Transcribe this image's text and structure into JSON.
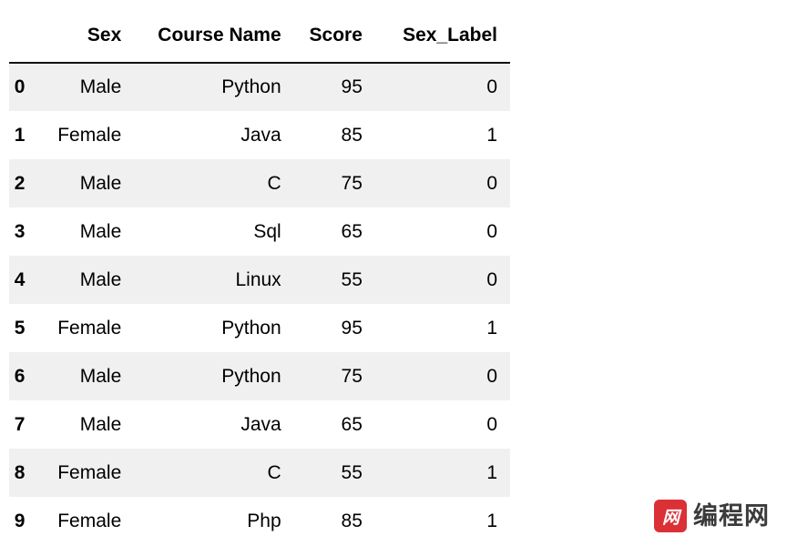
{
  "table": {
    "index_header": "",
    "columns": [
      "Sex",
      "Course Name",
      "Score",
      "Sex_Label"
    ],
    "rows": [
      {
        "index": "0",
        "sex": "Male",
        "course": "Python",
        "score": "95",
        "sex_label": "0"
      },
      {
        "index": "1",
        "sex": "Female",
        "course": "Java",
        "score": "85",
        "sex_label": "1"
      },
      {
        "index": "2",
        "sex": "Male",
        "course": "C",
        "score": "75",
        "sex_label": "0"
      },
      {
        "index": "3",
        "sex": "Male",
        "course": "Sql",
        "score": "65",
        "sex_label": "0"
      },
      {
        "index": "4",
        "sex": "Male",
        "course": "Linux",
        "score": "55",
        "sex_label": "0"
      },
      {
        "index": "5",
        "sex": "Female",
        "course": "Python",
        "score": "95",
        "sex_label": "1"
      },
      {
        "index": "6",
        "sex": "Male",
        "course": "Python",
        "score": "75",
        "sex_label": "0"
      },
      {
        "index": "7",
        "sex": "Male",
        "course": "Java",
        "score": "65",
        "sex_label": "0"
      },
      {
        "index": "8",
        "sex": "Female",
        "course": "C",
        "score": "55",
        "sex_label": "1"
      },
      {
        "index": "9",
        "sex": "Female",
        "course": "Php",
        "score": "85",
        "sex_label": "1"
      }
    ],
    "stripe_color": "#f0f0f0",
    "background_color": "#ffffff",
    "header_rule_color": "#111111"
  },
  "watermark": {
    "badge_text": "网",
    "text": "编程网",
    "subtitle": "",
    "badge_color": "#d81f26",
    "text_color": "#2b2b2b"
  }
}
